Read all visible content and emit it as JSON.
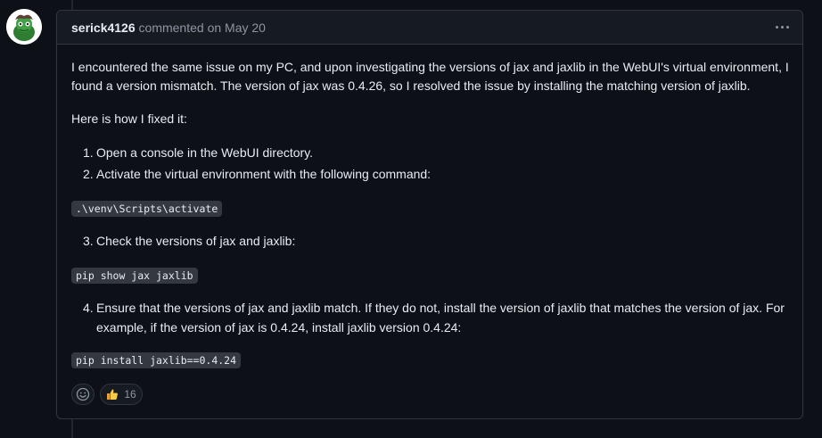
{
  "comment": {
    "author": "serick4126",
    "action": "commented on",
    "date": "May 20",
    "paragraphs": {
      "p1": "I encountered the same issue on my PC, and upon investigating the versions of jax and jaxlib in the WebUI's virtual environment, I found a version mismatch. The version of jax was 0.4.26, so I resolved the issue by installing the matching version of jaxlib.",
      "p2": "Here is how I fixed it:"
    },
    "steps": [
      {
        "num": "1.",
        "text": "Open a console in the WebUI directory."
      },
      {
        "num": "2.",
        "text": "Activate the virtual environment with the following command:"
      },
      {
        "num": "3.",
        "text": "Check the versions of jax and jaxlib:"
      },
      {
        "num": "4.",
        "text": "Ensure that the versions of jax and jaxlib match. If they do not, install the version of jaxlib that matches the version of jax. For example, if the version of jax is 0.4.24, install jaxlib version 0.4.24:"
      }
    ],
    "code": {
      "activate": ".\\venv\\Scripts\\activate",
      "show": "pip show jax jaxlib",
      "install": "pip install jaxlib==0.4.24"
    },
    "reactions": {
      "thumbs_count": "16"
    }
  },
  "icons": {
    "menu": "kebab-horizontal-icon",
    "smiley": "smiley-icon",
    "thumbs": "thumbs-up-icon"
  },
  "colors": {
    "background": "#0d1117",
    "header_bg": "#161b22",
    "border": "#30363d",
    "muted": "#8d96a0",
    "code_bg": "#343941"
  }
}
